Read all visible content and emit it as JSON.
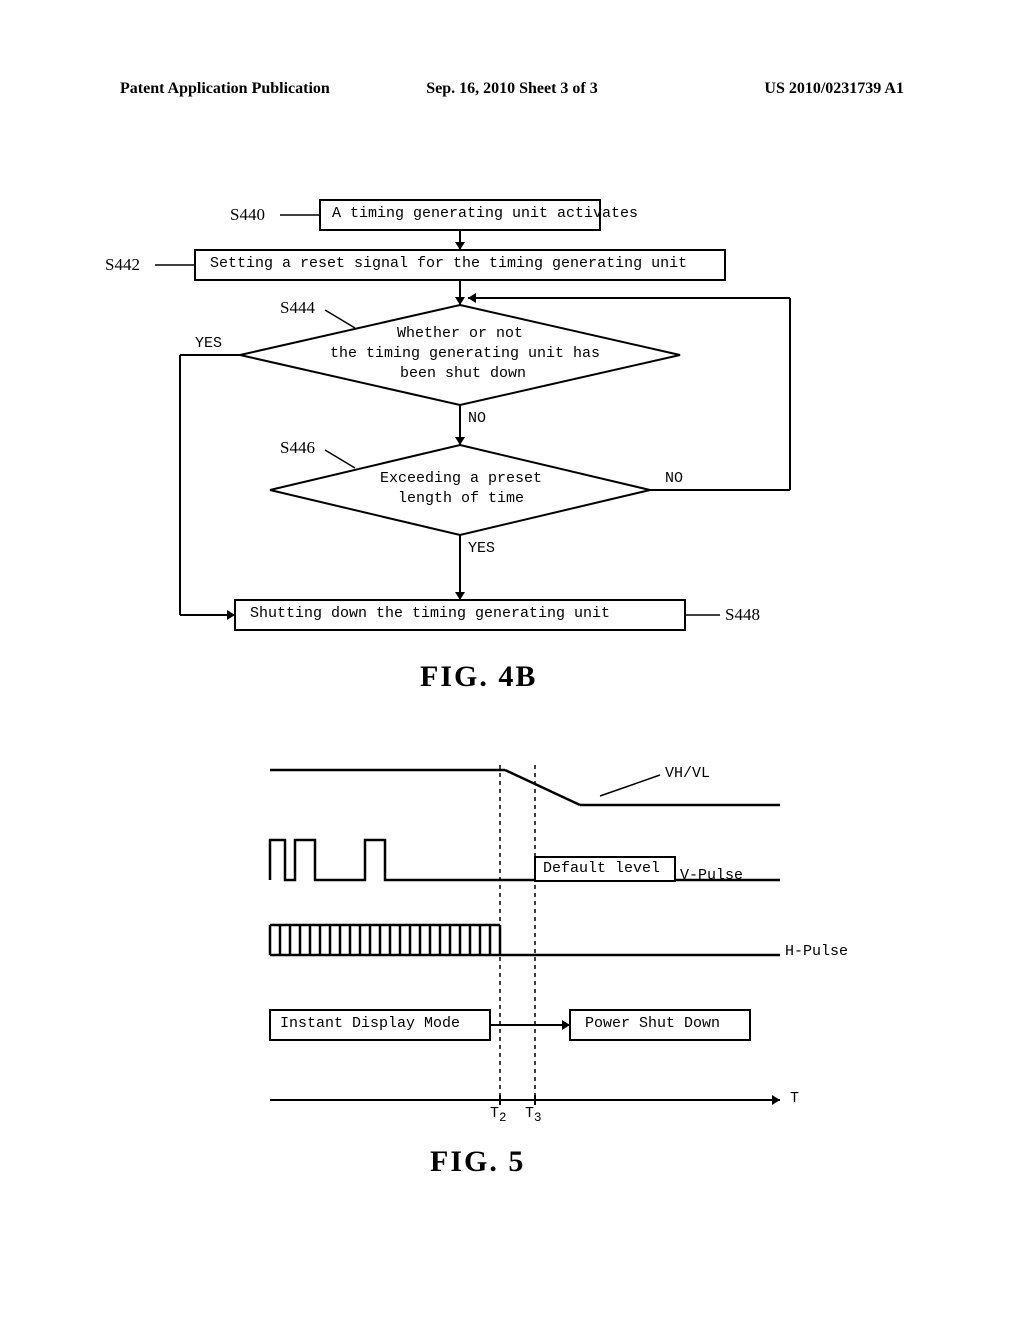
{
  "header": {
    "left": "Patent Application Publication",
    "center": "Sep. 16, 2010   Sheet 3 of 3",
    "right": "US 2010/0231739 A1"
  },
  "fig4b": {
    "label": "FIG. 4B",
    "steps": {
      "s440": {
        "ref": "S440",
        "text": "A  timing  generating  unit  activates"
      },
      "s442": {
        "ref": "S442",
        "text": "Setting  a  reset  signal  for  the  timing  generating  unit"
      },
      "s444": {
        "ref": "S444",
        "line1": "Whether or not",
        "line2": "the timing generating unit has",
        "line3": "been shut down",
        "yes": "YES",
        "no": "NO"
      },
      "s446": {
        "ref": "S446",
        "line1": "Exceeding a preset",
        "line2": "length of time",
        "yes": "YES",
        "no": "NO"
      },
      "s448": {
        "ref": "S448",
        "text": "Shutting  down  the  timing  generating  unit"
      }
    }
  },
  "fig5": {
    "label": "FIG. 5",
    "vhvl": "VH/VL",
    "vpulse": "V-Pulse",
    "default_level": "Default level",
    "hpulse": "H-Pulse",
    "instant": "Instant Display Mode",
    "shutdown": "Power Shut Down",
    "t": "T",
    "t2": "T",
    "t2sub": "2",
    "t3": "T",
    "t3sub": "3"
  }
}
